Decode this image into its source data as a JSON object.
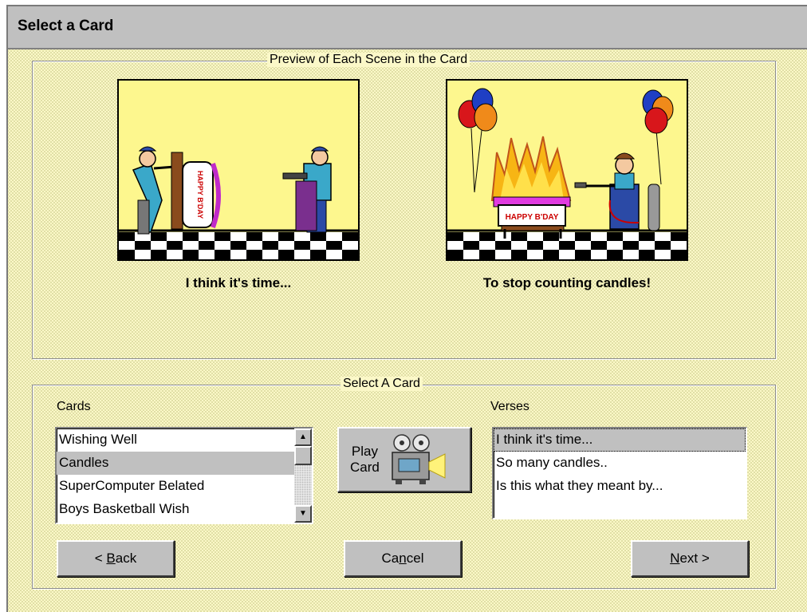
{
  "window": {
    "title": "Select a Card"
  },
  "preview": {
    "group_label": "Preview of Each Scene in the Card",
    "scenes": [
      {
        "caption": "I think it's time...",
        "banner_text": "HAPPY B'DAY"
      },
      {
        "caption": "To stop counting candles!",
        "banner_text": "HAPPY B'DAY"
      }
    ]
  },
  "select": {
    "group_label": "Select A Card",
    "cards_label": "Cards",
    "cards": [
      "Wishing Well",
      "Candles",
      "SuperComputer Belated",
      "Boys Basketball Wish"
    ],
    "selected_card_index": 1,
    "verses_label": "Verses",
    "verses": [
      "I think it's time...",
      "So many candles..",
      "Is this what they meant by..."
    ],
    "selected_verse_index": 0,
    "play_button": {
      "line1": "Play",
      "line2": "Card",
      "icon": "film-projector-icon"
    }
  },
  "buttons": {
    "back": {
      "prefix": "< ",
      "mnemonic": "B",
      "rest": "ack"
    },
    "cancel": {
      "prefix": "Ca",
      "mnemonic": "n",
      "rest": "cel"
    },
    "next": {
      "prefix": "",
      "mnemonic": "N",
      "rest": "ext >"
    }
  },
  "colors": {
    "background": "#fbf8c8",
    "scene_background": "#fdf78e",
    "button_face": "#c0c0c0",
    "selection": "#c0c0c0"
  }
}
